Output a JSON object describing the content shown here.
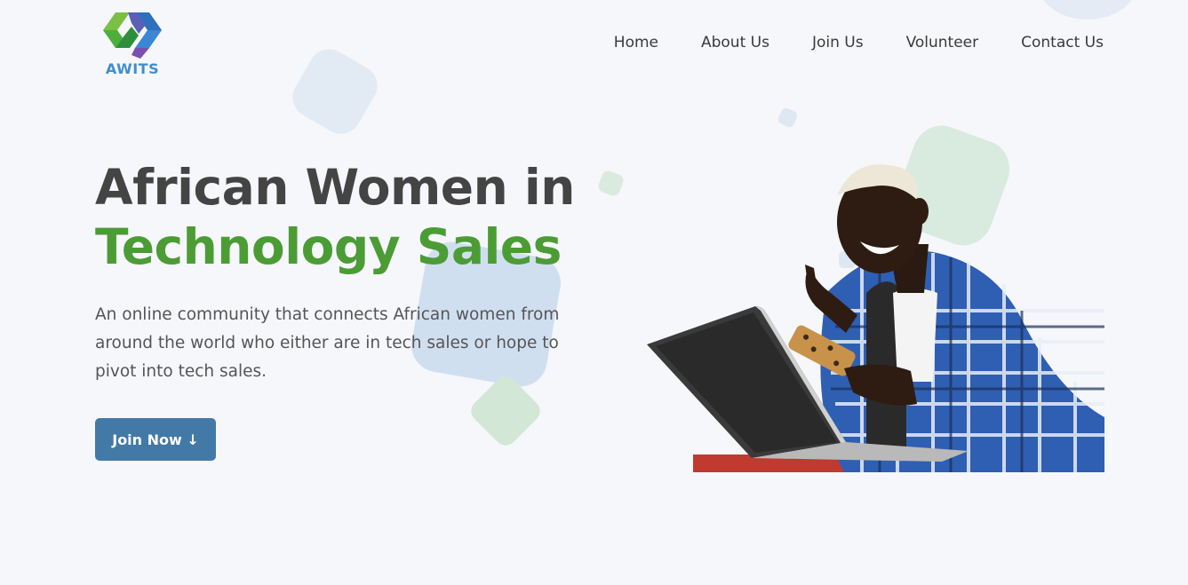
{
  "brand": {
    "name": "AWITS",
    "colors": {
      "blue": "#3f8fd0",
      "green": "#4c9c36",
      "button": "#4379a6",
      "heading": "#444444"
    }
  },
  "nav": {
    "items": [
      {
        "label": "Home"
      },
      {
        "label": "About Us"
      },
      {
        "label": "Join Us"
      },
      {
        "label": "Volunteer"
      },
      {
        "label": "Contact Us"
      }
    ]
  },
  "hero": {
    "title_line1": "African Women in",
    "title_line2": "Technology Sales",
    "description": "An online community that connects African women from around the world who either are in tech sales or hope to pivot into tech sales.",
    "cta_label": "Join Now ↓",
    "image_icon": "woman-with-laptop-and-phone-photo"
  }
}
